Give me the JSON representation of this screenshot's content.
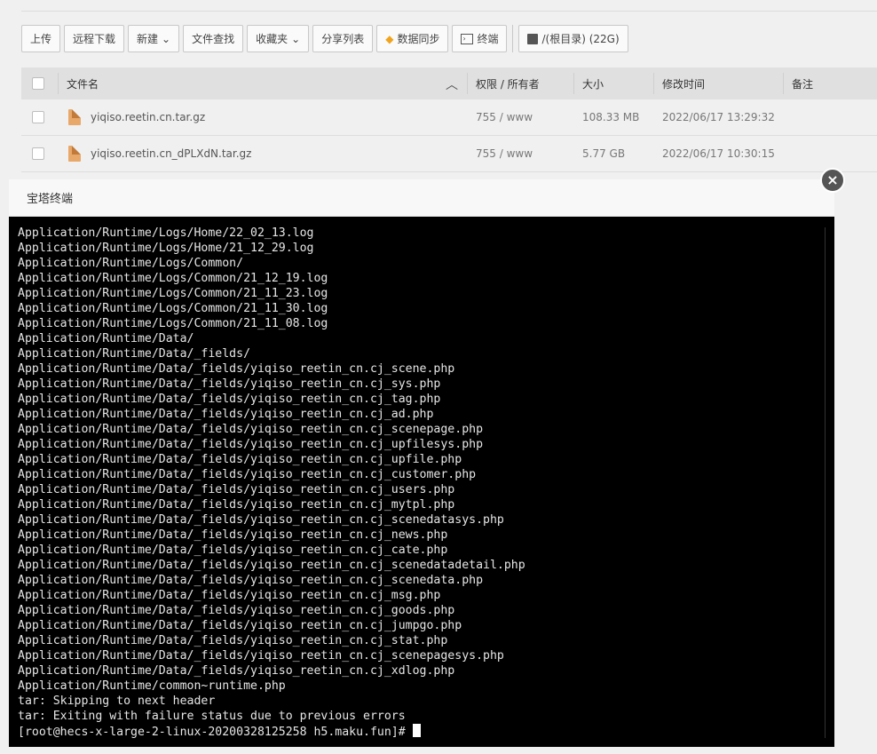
{
  "toolbar": {
    "upload": "上传",
    "remote_download": "远程下载",
    "new": "新建",
    "file_search": "文件查找",
    "favorites": "收藏夹",
    "share_list": "分享列表",
    "data_sync": "数据同步",
    "terminal": "终端",
    "disk": "/(根目录) (22G)"
  },
  "table": {
    "headers": {
      "name": "文件名",
      "perm": "权限 / 所有者",
      "size": "大小",
      "mtime": "修改时间",
      "note": "备注"
    },
    "rows": [
      {
        "name": "yiqiso.reetin.cn.tar.gz",
        "perm": "755 / www",
        "size": "108.33 MB",
        "mtime": "2022/06/17 13:29:32"
      },
      {
        "name": "yiqiso.reetin.cn_dPLXdN.tar.gz",
        "perm": "755 / www",
        "size": "5.77 GB",
        "mtime": "2022/06/17 10:30:15"
      }
    ]
  },
  "modal": {
    "title": "宝塔终端",
    "close_glyph": "×",
    "lines": [
      "Application/Runtime/Logs/Home/22_02_13.log",
      "Application/Runtime/Logs/Home/21_12_29.log",
      "Application/Runtime/Logs/Common/",
      "Application/Runtime/Logs/Common/21_12_19.log",
      "Application/Runtime/Logs/Common/21_11_23.log",
      "Application/Runtime/Logs/Common/21_11_30.log",
      "Application/Runtime/Logs/Common/21_11_08.log",
      "Application/Runtime/Data/",
      "Application/Runtime/Data/_fields/",
      "Application/Runtime/Data/_fields/yiqiso_reetin_cn.cj_scene.php",
      "Application/Runtime/Data/_fields/yiqiso_reetin_cn.cj_sys.php",
      "Application/Runtime/Data/_fields/yiqiso_reetin_cn.cj_tag.php",
      "Application/Runtime/Data/_fields/yiqiso_reetin_cn.cj_ad.php",
      "Application/Runtime/Data/_fields/yiqiso_reetin_cn.cj_scenepage.php",
      "Application/Runtime/Data/_fields/yiqiso_reetin_cn.cj_upfilesys.php",
      "Application/Runtime/Data/_fields/yiqiso_reetin_cn.cj_upfile.php",
      "Application/Runtime/Data/_fields/yiqiso_reetin_cn.cj_customer.php",
      "Application/Runtime/Data/_fields/yiqiso_reetin_cn.cj_users.php",
      "Application/Runtime/Data/_fields/yiqiso_reetin_cn.cj_mytpl.php",
      "Application/Runtime/Data/_fields/yiqiso_reetin_cn.cj_scenedatasys.php",
      "Application/Runtime/Data/_fields/yiqiso_reetin_cn.cj_news.php",
      "Application/Runtime/Data/_fields/yiqiso_reetin_cn.cj_cate.php",
      "Application/Runtime/Data/_fields/yiqiso_reetin_cn.cj_scenedatadetail.php",
      "Application/Runtime/Data/_fields/yiqiso_reetin_cn.cj_scenedata.php",
      "Application/Runtime/Data/_fields/yiqiso_reetin_cn.cj_msg.php",
      "Application/Runtime/Data/_fields/yiqiso_reetin_cn.cj_goods.php",
      "Application/Runtime/Data/_fields/yiqiso_reetin_cn.cj_jumpgo.php",
      "Application/Runtime/Data/_fields/yiqiso_reetin_cn.cj_stat.php",
      "Application/Runtime/Data/_fields/yiqiso_reetin_cn.cj_scenepagesys.php",
      "Application/Runtime/Data/_fields/yiqiso_reetin_cn.cj_xdlog.php",
      "Application/Runtime/common~runtime.php",
      "tar: Skipping to next header",
      "tar: Exiting with failure status due to previous errors"
    ],
    "prompt": "[root@hecs-x-large-2-linux-20200328125258 h5.maku.fun]#"
  }
}
